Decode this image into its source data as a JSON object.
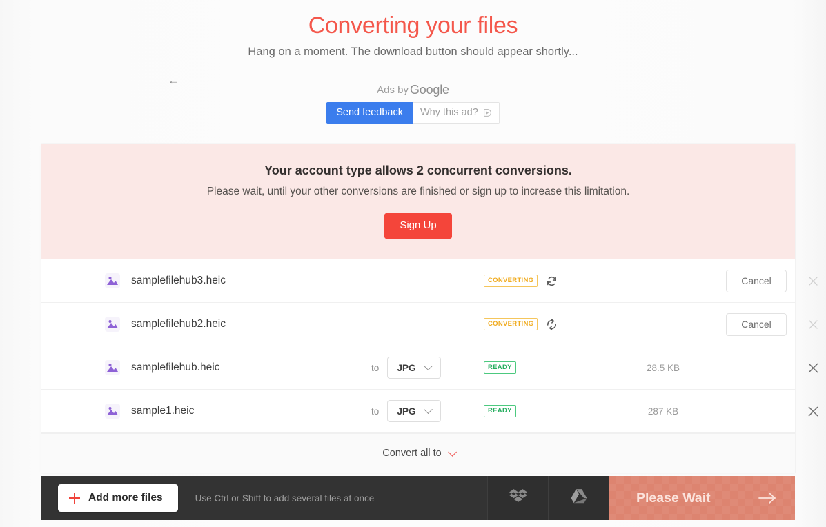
{
  "header": {
    "title": "Converting your files",
    "subtitle": "Hang on a moment. The download button should appear shortly..."
  },
  "ad": {
    "back_arrow": "←",
    "ads_by_prefix": "Ads by",
    "ads_by_brand": "Google",
    "send_feedback_label": "Send feedback",
    "why_this_ad_label": "Why this ad?"
  },
  "notice": {
    "title": "Your account type allows 2 concurrent conversions.",
    "subtitle": "Please wait, until your other conversions are finished or sign up to increase this limitation.",
    "signup_label": "Sign Up"
  },
  "files": {
    "to_label": "to",
    "cancel_label": "Cancel",
    "rows": [
      {
        "name": "samplefilehub3.heic",
        "status": "CONVERTING",
        "status_type": "converting",
        "format": "",
        "size": "",
        "action": "Cancel"
      },
      {
        "name": "samplefilehub2.heic",
        "status": "CONVERTING",
        "status_type": "converting",
        "format": "",
        "size": "",
        "action": "Cancel"
      },
      {
        "name": "samplefilehub.heic",
        "status": "READY",
        "status_type": "ready",
        "format": "JPG",
        "size": "28.5 KB",
        "action": ""
      },
      {
        "name": "sample1.heic",
        "status": "READY",
        "status_type": "ready",
        "format": "JPG",
        "size": "287 KB",
        "action": ""
      }
    ]
  },
  "convert_all": {
    "label": "Convert all to"
  },
  "bottom_bar": {
    "add_files_label": "Add more files",
    "hint": "Use Ctrl or Shift to add several files at once",
    "wait_label": "Please Wait"
  },
  "colors": {
    "title": "#f4574b",
    "accent_red": "#f4453a",
    "banner_bg": "#fbe8e6",
    "converting": "#f0ab1e",
    "ready": "#27ae60",
    "feedback_blue": "#3b7ded",
    "bar_dark": "#333333",
    "wait_salmon": "#dd8470",
    "file_icon_purple": "#8e62d6"
  }
}
